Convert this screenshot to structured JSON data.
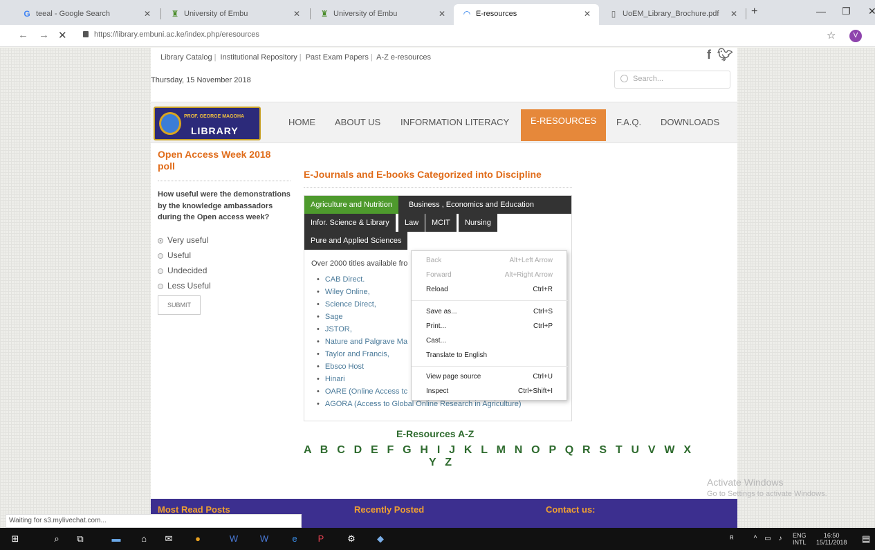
{
  "browser": {
    "tabs": [
      {
        "title": "teeal - Google Search",
        "icon": "G"
      },
      {
        "title": "University of Embu",
        "icon": "crest"
      },
      {
        "title": "University of Embu",
        "icon": "crest"
      },
      {
        "title": "E-resources",
        "icon": "loading"
      },
      {
        "title": "UoEM_Library_Brochure.pdf",
        "icon": "doc"
      }
    ],
    "url": "https://library.embuni.ac.ke/index.php/eresources",
    "profile_initial": "V"
  },
  "site": {
    "toplinks": [
      "Library Catalog",
      "Institutional Repository",
      "Past Exam Papers",
      "A-Z e-resources"
    ],
    "social": "f",
    "date": "Thursday, 15 November 2018",
    "search_placeholder": "Search...",
    "logo": {
      "line1": "PROF. GEORGE MAGOHA",
      "line2": "LIBRARY"
    },
    "menu": [
      "HOME",
      "ABOUT US",
      "INFORMATION LITERACY",
      "E-RESOURCES",
      "F.A.Q.",
      "DOWNLOADS"
    ]
  },
  "poll": {
    "title": "Open Access Week 2018 poll",
    "question": "How useful were the demonstrations by the knowledge ambassadors during the Open access week?",
    "options": [
      "Very useful",
      "Useful",
      "Undecided",
      "Less Useful"
    ],
    "submit": "SUBMIT"
  },
  "main": {
    "title": "E-Journals and E-books Categorized into Discipline",
    "tabs": [
      "Agriculture and Nutrition",
      "Business , Economics and Education",
      "Infor. Science & Library",
      "Law",
      "MCIT",
      "Nursing",
      "Pure and Applied Sciences"
    ],
    "intro": "Over 2000 titles available fro",
    "resources": [
      "CAB Direct.",
      "Wiley Online,",
      "Science Direct,",
      "Sage",
      "JSTOR,",
      "Nature and Palgrave Ma",
      "Taylor and Francis,",
      "Ebsco Host",
      "Hinari",
      "OARE (Online Access tc",
      "AGORA (Access to Global Online Research in Agriculture)"
    ],
    "az_title": "E-Resources A-Z",
    "az_row1": "A B C D E F G H I J K L M N O P Q R S T U V W X",
    "az_row2": "Y Z"
  },
  "footer": {
    "col1": "Most Read Posts",
    "col2": "Recently Posted",
    "col3": "Contact us:"
  },
  "context_menu": [
    {
      "label": "Back",
      "shortcut": "Alt+Left Arrow",
      "disabled": true
    },
    {
      "label": "Forward",
      "shortcut": "Alt+Right Arrow",
      "disabled": true
    },
    {
      "label": "Reload",
      "shortcut": "Ctrl+R",
      "disabled": false
    },
    {
      "label": "Save as...",
      "shortcut": "Ctrl+S",
      "disabled": false
    },
    {
      "label": "Print...",
      "shortcut": "Ctrl+P",
      "disabled": false
    },
    {
      "label": "Cast...",
      "shortcut": "",
      "disabled": false
    },
    {
      "label": "Translate to English",
      "shortcut": "",
      "disabled": false
    },
    {
      "label": "View page source",
      "shortcut": "Ctrl+U",
      "disabled": false
    },
    {
      "label": "Inspect",
      "shortcut": "Ctrl+Shift+I",
      "disabled": false
    }
  ],
  "status_text": "Waiting for s3.mylivechat.com...",
  "watermark": {
    "line1": "Activate Windows",
    "line2": "Go to Settings to activate Windows."
  },
  "taskbar": {
    "lang1": "ENG",
    "lang2": "INTL",
    "time": "16:50",
    "date": "15/11/2018"
  },
  "colors": {
    "accent": "#e6883a",
    "green": "#4e9a2d",
    "footer": "#3c2f8f",
    "title": "#e06c1a"
  }
}
